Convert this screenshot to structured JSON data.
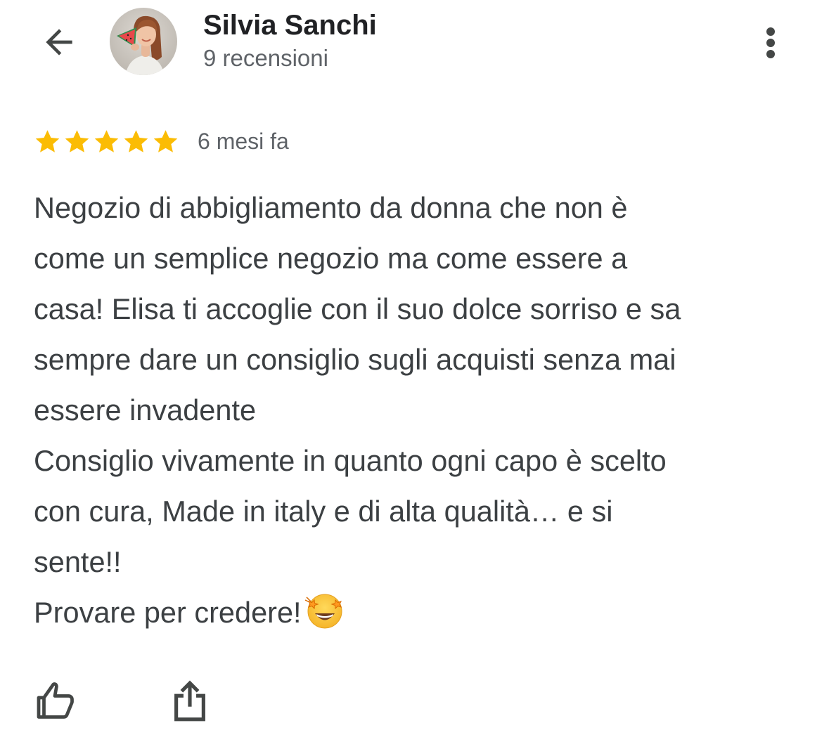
{
  "header": {
    "author_name": "Silvia Sanchi",
    "review_count": "9 recensioni",
    "back_icon": "arrow-left-icon",
    "more_icon": "more-vertical-icon",
    "avatar_icon": "profile-photo"
  },
  "review": {
    "rating": 5,
    "rating_max": 5,
    "star_color": "#fbbc04",
    "date": "6 mesi fa",
    "lines": [
      "Negozio di abbigliamento da donna che non è",
      "come un semplice negozio ma come essere a",
      "casa! Elisa ti accoglie con il suo dolce sorriso e sa",
      "sempre dare un consiglio sugli acquisti senza mai",
      "essere invadente",
      "Consiglio vivamente in quanto ogni capo è scelto",
      "con cura, Made in italy e di alta qualità… e si",
      "sente!!",
      "Provare per credere!"
    ],
    "trailing_emoji": "star-struck-emoji"
  },
  "actions": {
    "like_icon": "thumbs-up-icon",
    "share_icon": "share-icon"
  },
  "colors": {
    "text_primary": "#202124",
    "text_secondary": "#5f6368",
    "body_text": "#3c4043",
    "icon": "#444746"
  }
}
